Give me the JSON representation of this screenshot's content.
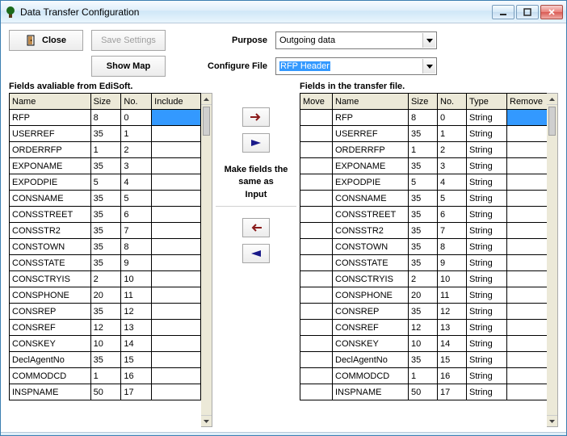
{
  "window": {
    "title": "Data Transfer Configuration"
  },
  "buttons": {
    "close": "Close",
    "save_settings": "Save Settings",
    "show_map": "Show Map"
  },
  "labels": {
    "purpose": "Purpose",
    "configure_file": "Configure File",
    "make_same": "Make fields the same as",
    "input": "Input"
  },
  "selects": {
    "purpose_value": "Outgoing data",
    "configure_file_value": "RFP Header"
  },
  "left": {
    "title": "Fields avaliable from EdiSoft.",
    "columns": {
      "name": "Name",
      "size": "Size",
      "no": "No.",
      "include": "Include"
    },
    "rows": [
      {
        "name": "RFP",
        "size": "8",
        "no": "0"
      },
      {
        "name": "USERREF",
        "size": "35",
        "no": "1"
      },
      {
        "name": "ORDERRFP",
        "size": "1",
        "no": "2"
      },
      {
        "name": "EXPONAME",
        "size": "35",
        "no": "3"
      },
      {
        "name": "EXPODPIE",
        "size": "5",
        "no": "4"
      },
      {
        "name": "CONSNAME",
        "size": "35",
        "no": "5"
      },
      {
        "name": "CONSSTREET",
        "size": "35",
        "no": "6"
      },
      {
        "name": "CONSSTR2",
        "size": "35",
        "no": "7"
      },
      {
        "name": "CONSTOWN",
        "size": "35",
        "no": "8"
      },
      {
        "name": "CONSSTATE",
        "size": "35",
        "no": "9"
      },
      {
        "name": "CONSCTRYIS",
        "size": "2",
        "no": "10"
      },
      {
        "name": "CONSPHONE",
        "size": "20",
        "no": "11"
      },
      {
        "name": "CONSREP",
        "size": "35",
        "no": "12"
      },
      {
        "name": "CONSREF",
        "size": "12",
        "no": "13"
      },
      {
        "name": "CONSKEY",
        "size": "10",
        "no": "14"
      },
      {
        "name": "DeclAgentNo",
        "size": "35",
        "no": "15"
      },
      {
        "name": "COMMODCD",
        "size": "1",
        "no": "16"
      },
      {
        "name": "INSPNAME",
        "size": "50",
        "no": "17"
      }
    ]
  },
  "right": {
    "title": "Fields in the transfer file.",
    "columns": {
      "move": "Move",
      "name": "Name",
      "size": "Size",
      "no": "No.",
      "type": "Type",
      "remove": "Remove"
    },
    "rows": [
      {
        "name": "RFP",
        "size": "8",
        "no": "0",
        "type": "String"
      },
      {
        "name": "USERREF",
        "size": "35",
        "no": "1",
        "type": "String"
      },
      {
        "name": "ORDERRFP",
        "size": "1",
        "no": "2",
        "type": "String"
      },
      {
        "name": "EXPONAME",
        "size": "35",
        "no": "3",
        "type": "String"
      },
      {
        "name": "EXPODPIE",
        "size": "5",
        "no": "4",
        "type": "String"
      },
      {
        "name": "CONSNAME",
        "size": "35",
        "no": "5",
        "type": "String"
      },
      {
        "name": "CONSSTREET",
        "size": "35",
        "no": "6",
        "type": "String"
      },
      {
        "name": "CONSSTR2",
        "size": "35",
        "no": "7",
        "type": "String"
      },
      {
        "name": "CONSTOWN",
        "size": "35",
        "no": "8",
        "type": "String"
      },
      {
        "name": "CONSSTATE",
        "size": "35",
        "no": "9",
        "type": "String"
      },
      {
        "name": "CONSCTRYIS",
        "size": "2",
        "no": "10",
        "type": "String"
      },
      {
        "name": "CONSPHONE",
        "size": "20",
        "no": "11",
        "type": "String"
      },
      {
        "name": "CONSREP",
        "size": "35",
        "no": "12",
        "type": "String"
      },
      {
        "name": "CONSREF",
        "size": "12",
        "no": "13",
        "type": "String"
      },
      {
        "name": "CONSKEY",
        "size": "10",
        "no": "14",
        "type": "String"
      },
      {
        "name": "DeclAgentNo",
        "size": "35",
        "no": "15",
        "type": "String"
      },
      {
        "name": "COMMODCD",
        "size": "1",
        "no": "16",
        "type": "String"
      },
      {
        "name": "INSPNAME",
        "size": "50",
        "no": "17",
        "type": "String"
      }
    ]
  }
}
